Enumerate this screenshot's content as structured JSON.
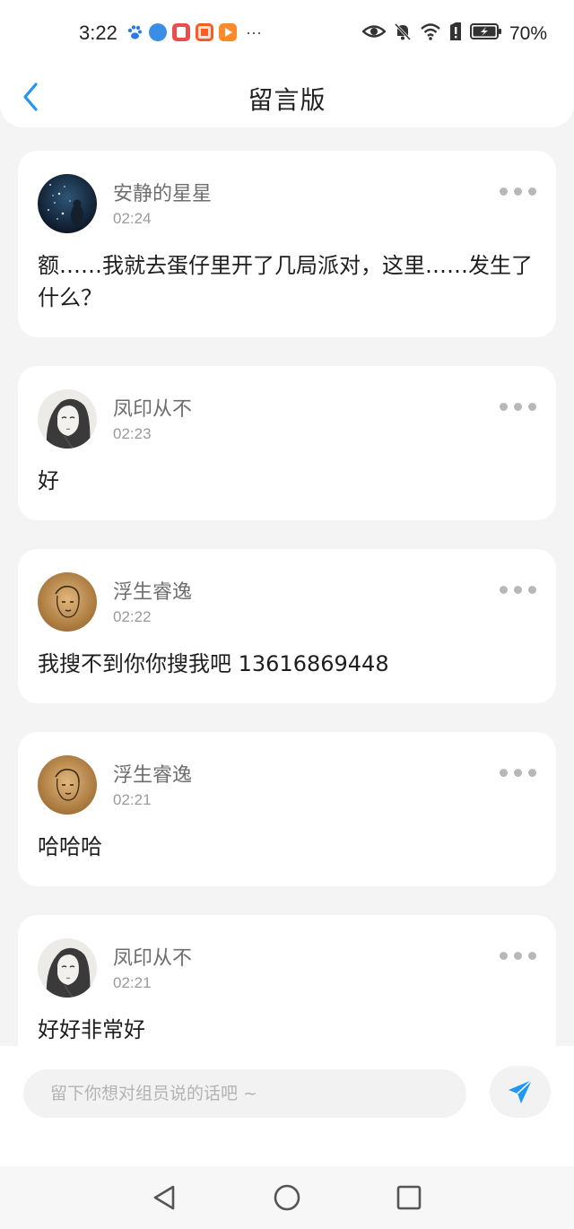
{
  "status_bar": {
    "time": "3:22",
    "more_apps": "···",
    "battery_percent": "70%"
  },
  "header": {
    "title": "留言版",
    "back_icon": "chevron-left-icon"
  },
  "messages": [
    {
      "author": "安静的星星",
      "time": "02:24",
      "text": "额……我就去蛋仔里开了几局派对，这里……发生了什么？",
      "avatar": "starry-night-avatar"
    },
    {
      "author": "凤印从不",
      "time": "02:23",
      "text": "好",
      "avatar": "sketch-girl-avatar"
    },
    {
      "author": "浮生睿逸",
      "time": "02:22",
      "text": "我搜不到你你搜我吧  13616869448",
      "avatar": "sepia-sketch-avatar"
    },
    {
      "author": "浮生睿逸",
      "time": "02:21",
      "text": "哈哈哈",
      "avatar": "sepia-sketch-avatar"
    },
    {
      "author": "凤印从不",
      "time": "02:21",
      "text": "好好非常好",
      "avatar": "sketch-girl-avatar"
    }
  ],
  "composer": {
    "placeholder": "留下你想对组员说的话吧 ~",
    "send_icon": "send-icon"
  },
  "colors": {
    "accent": "#2196f3",
    "background": "#f4f4f4",
    "card": "#ffffff",
    "author_text": "#6e6e6e",
    "time_text": "#9a9a9a"
  }
}
